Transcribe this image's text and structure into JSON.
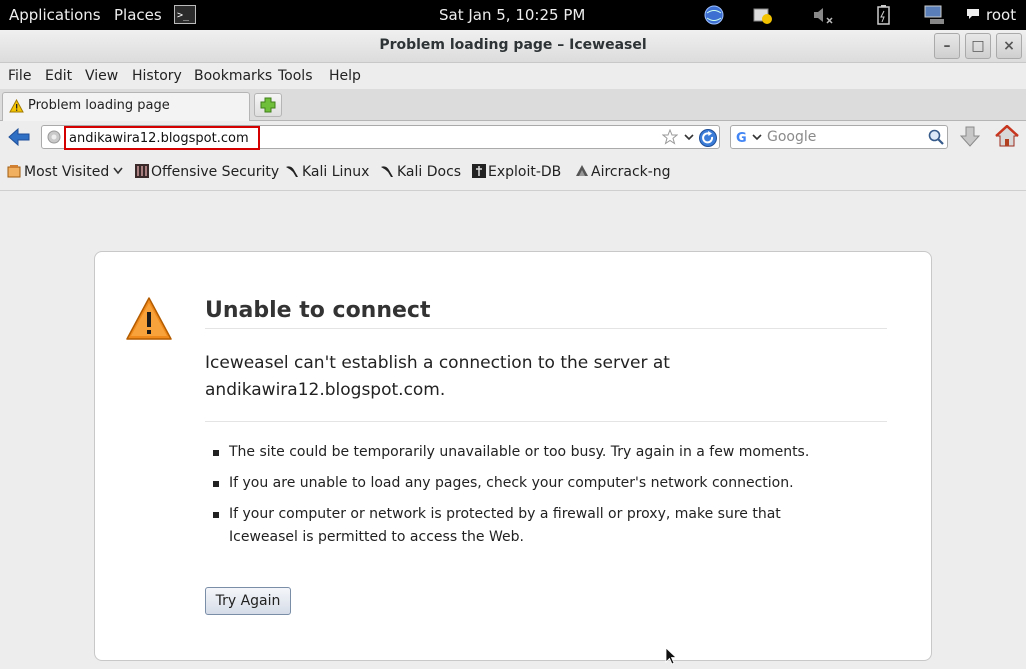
{
  "panel": {
    "applications": "Applications",
    "places": "Places",
    "terminal_icon": "terminal-icon",
    "clock": "Sat Jan  5, 10:25 PM",
    "user": "root",
    "tray_icons": [
      "network-globe-icon",
      "update-notifier-icon",
      "volume-muted-icon",
      "battery-icon",
      "network-computer-icon",
      "chat-bubble-icon"
    ]
  },
  "window": {
    "title": "Problem loading page – Iceweasel"
  },
  "menubar": {
    "items": [
      "File",
      "Edit",
      "View",
      "History",
      "Bookmarks",
      "Tools",
      "Help"
    ],
    "mnemonics": [
      "F",
      "E",
      "V",
      "s",
      "B",
      "T",
      "H"
    ]
  },
  "tab": {
    "label": "Problem loading page",
    "icon": "warning-icon"
  },
  "navbar": {
    "url": "andikawira12.blogspot.com",
    "search_placeholder": "Google"
  },
  "bookmarks": [
    {
      "label": "Most Visited",
      "icon": "most-visited-icon"
    },
    {
      "label": "Offensive Security",
      "icon": "offensive-security-icon"
    },
    {
      "label": "Kali Linux",
      "icon": "kali-dragon-icon"
    },
    {
      "label": "Kali Docs",
      "icon": "kali-dragon-icon"
    },
    {
      "label": "Exploit-DB",
      "icon": "exploit-db-icon"
    },
    {
      "label": "Aircrack-ng",
      "icon": "aircrack-icon"
    }
  ],
  "error": {
    "title": "Unable to connect",
    "description": "Iceweasel can't establish a connection to the server at andikawira12.blogspot.com.",
    "bullets": [
      "The site could be temporarily unavailable or too busy. Try again in a few moments.",
      "If you are unable to load any pages, check your computer's network connection.",
      "If your computer or network is protected by a firewall or proxy, make sure that Iceweasel is permitted to access the Web."
    ],
    "button": "Try Again"
  },
  "colors": {
    "panel_bg": "#000000",
    "highlight_box": "#d40000",
    "warning_orange": "#f08a1c"
  }
}
